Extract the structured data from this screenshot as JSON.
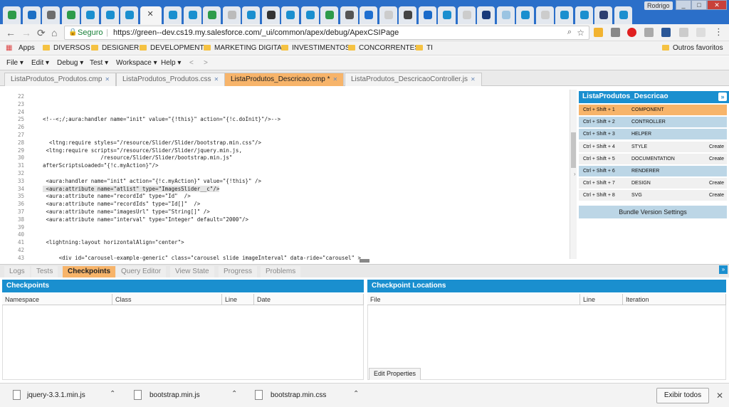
{
  "browser": {
    "user": "Rodrigo",
    "address": {
      "secure_label": "Seguro",
      "url": "https://green--dev.cs19.my.salesforce.com/_ui/common/apex/debug/ApexCSIPage"
    },
    "bookmarks": [
      "Apps",
      "DIVERSOS",
      "DESIGNER",
      "DEVELOPMENT",
      "MARKETING DIGITAL",
      "INVESTIMENTOS",
      "CONCORRENTES",
      "TI"
    ],
    "other_bookmarks": "Outros favoritos"
  },
  "console": {
    "menus": [
      "File",
      "Edit",
      "Debug",
      "Test",
      "Workspace",
      "Help"
    ],
    "file_tabs": [
      "ListaProdutos_Produtos.cmp",
      "ListaProdutos_Produtos.css",
      "ListaProdutos_Descricao.cmp *",
      "ListaProdutos_DescricaoController.js"
    ],
    "active_file_tab": 2,
    "line_numbers": [
      "22",
      "23",
      "24",
      "25",
      "26",
      "27",
      "28",
      "29",
      "30",
      "31",
      "32",
      "33",
      "34",
      "35",
      "36",
      "37",
      "38",
      "39",
      "40",
      "41",
      "42",
      "43"
    ],
    "code_lines": [
      {
        "line": "25",
        "text": "<!--<;/;aura:handler name=\"init\" value=\"{!this}\" action=\"{!c.doInit}\"/>-->"
      },
      {
        "line": "28",
        "text": "  <ltng:require styles=\"/resource/Slider/Slider/bootstrap.min.css\"/>"
      },
      {
        "line": "29",
        "text": " <ltng:require scripts=\"/resource/Slider/Slider/jquery.min.js,"
      },
      {
        "line": "30",
        "text": "                  /resource/Slider/Slider/bootstrap.min.js\""
      },
      {
        "line": "31",
        "text": "afterScriptsLoaded=\"{!c.myAction}\"/>"
      },
      {
        "line": "33",
        "text": " <aura:handler name=\"init\" action=\"{!c.myAction}\" value=\"{!this}\" />"
      },
      {
        "line": "34",
        "text": " <aura:attribute name=\"atlist\" type=\"ImagesSlider__c\"/>"
      },
      {
        "line": "35",
        "text": " <aura:attribute name=\"recordId\" type=\"Id\"  />"
      },
      {
        "line": "36",
        "text": " <aura:attribute name=\"recordIds\" type=\"Id[]\"  />"
      },
      {
        "line": "37",
        "text": " <aura:attribute name=\"imagesUrl\" type=\"String[]\" />"
      },
      {
        "line": "38",
        "text": " <aura:attribute name=\"interval\" type=\"Integer\" default=\"2000\"/>"
      },
      {
        "line": "41",
        "text": " <lightning:layout horizontalAlign=\"center\">"
      },
      {
        "line": "43",
        "text": "     <div id=\"carousel-example-generic\" class=\"carousel slide imageInterval\" data-ride=\"carousel\" >"
      }
    ],
    "highlighted_line": "34",
    "bundle": {
      "title": "ListaProdutos_Descricao",
      "rows": [
        {
          "keys": "Ctrl + Shift + 1",
          "name": "COMPONENT",
          "action": ""
        },
        {
          "keys": "Ctrl + Shift + 2",
          "name": "CONTROLLER",
          "action": ""
        },
        {
          "keys": "Ctrl + Shift + 3",
          "name": "HELPER",
          "action": ""
        },
        {
          "keys": "Ctrl + Shift + 4",
          "name": "STYLE",
          "action": "Create"
        },
        {
          "keys": "Ctrl + Shift + 5",
          "name": "DOCUMENTATION",
          "action": "Create"
        },
        {
          "keys": "Ctrl + Shift + 6",
          "name": "RENDERER",
          "action": ""
        },
        {
          "keys": "Ctrl + Shift + 7",
          "name": "DESIGN",
          "action": "Create"
        },
        {
          "keys": "Ctrl + Shift + 8",
          "name": "SVG",
          "action": "Create"
        }
      ],
      "version_settings": "Bundle Version Settings"
    },
    "bottom_tabs": [
      "Logs",
      "Tests",
      "Checkpoints",
      "Query Editor",
      "View State",
      "Progress",
      "Problems"
    ],
    "active_bottom_tab": 2,
    "checkpoints": {
      "title": "Checkpoints",
      "columns": [
        "Namespace",
        "Class",
        "Line",
        "Date"
      ]
    },
    "locations": {
      "title": "Checkpoint Locations",
      "columns": [
        "File",
        "Line",
        "Iteration"
      ],
      "edit_props": "Edit Properties"
    }
  },
  "downloads": {
    "items": [
      "jquery-3.3.1.min.js",
      "bootstrap.min.js",
      "bootstrap.min.css"
    ],
    "show_all": "Exibir todos"
  },
  "colors": {
    "accent": "#1a8fcf",
    "active_tab": "#f7b46a",
    "row": "#bcd6e6"
  }
}
